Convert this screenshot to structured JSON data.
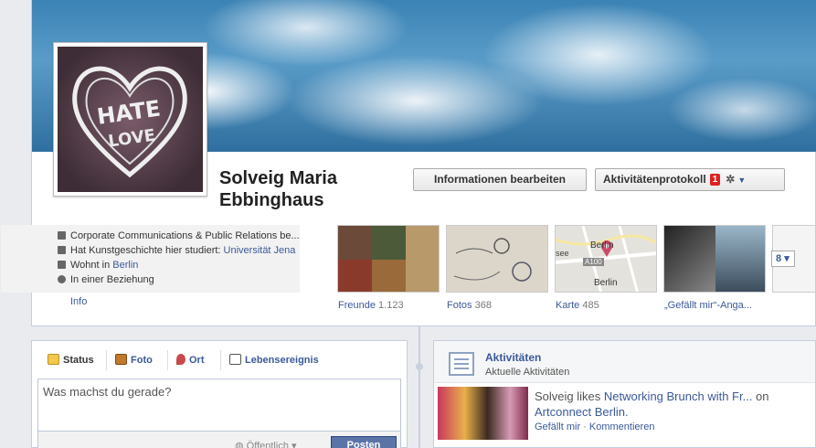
{
  "profile": {
    "name": "Solveig Maria Ebbinghaus"
  },
  "actions": {
    "edit_info": "Informationen bearbeiten",
    "activity_log": "Aktivitätenprotokoll",
    "activity_log_badge": "1"
  },
  "about": {
    "lines": [
      {
        "icon": "briefcase-icon",
        "text": "Corporate Communications & Public Relations be...",
        "link": ""
      },
      {
        "icon": "graduation-cap-icon",
        "text": "Hat Kunstgeschichte hier studiert: ",
        "link": "Universität Jena"
      },
      {
        "icon": "home-icon",
        "text": "Wohnt in ",
        "link": "Berlin"
      },
      {
        "icon": "heart-icon",
        "text": "In einer Beziehung",
        "link": ""
      }
    ],
    "info_link": "Info"
  },
  "tiles": {
    "friends": {
      "label": "Freunde",
      "count": "1.123"
    },
    "photos": {
      "label": "Fotos",
      "count": "368"
    },
    "map": {
      "label": "Karte",
      "count": "485",
      "place_top": "Berlin",
      "place_bottom": "Berlin",
      "road": "A100",
      "lake": "see"
    },
    "likes": {
      "label": "„Gefällt mir“-Anga..."
    },
    "more_count": "8"
  },
  "composer": {
    "tabs": [
      {
        "icon": "status-icon",
        "label": "Status"
      },
      {
        "icon": "camera-icon",
        "label": "Foto"
      },
      {
        "icon": "location-pin-icon",
        "label": "Ort"
      },
      {
        "icon": "book-icon",
        "label": "Lebensereignis"
      }
    ],
    "placeholder": "Was machst du gerade?",
    "audience": "Öffentlich",
    "post_label": "Posten"
  },
  "activity": {
    "title": "Aktivitäten",
    "subtitle": "Aktuelle Aktivitäten",
    "story": {
      "actor": "Solveig likes ",
      "object": "Networking Brunch with Fr...",
      "connector": " on ",
      "page": "Artconnect Berlin.",
      "like_action": "Gefällt mir",
      "separator": " · ",
      "comment_action": "Kommentieren"
    }
  },
  "colors": {
    "link": "#3b5998",
    "badge": "#e02020",
    "post_button": "#5b74a8"
  }
}
